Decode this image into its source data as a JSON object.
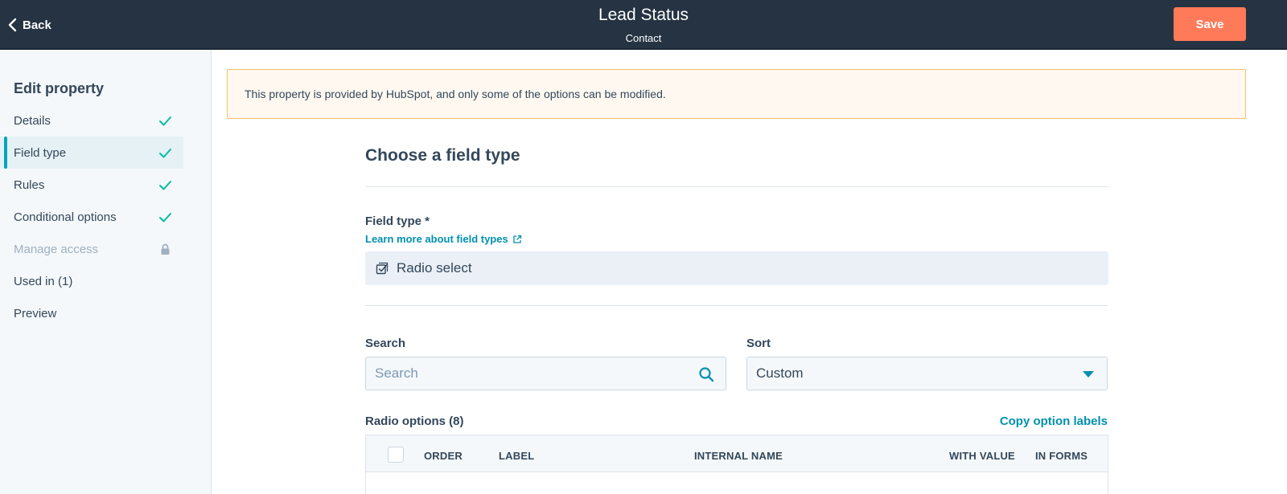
{
  "header": {
    "back_label": "Back",
    "title": "Lead Status",
    "subtitle": "Contact",
    "save_label": "Save"
  },
  "sidebar": {
    "title": "Edit property",
    "items": [
      {
        "label": "Details",
        "status": "check-icon"
      },
      {
        "label": "Field type",
        "status": "check-icon",
        "active": true
      },
      {
        "label": "Rules",
        "status": "check-icon"
      },
      {
        "label": "Conditional options",
        "status": "check-icon"
      },
      {
        "label": "Manage access",
        "status": "lock-icon",
        "disabled": true
      },
      {
        "label": "Used in (1)"
      },
      {
        "label": "Preview"
      }
    ]
  },
  "banner": {
    "text": "This property is provided by HubSpot, and only some of the options can be modified."
  },
  "main": {
    "section_title": "Choose a field type",
    "field_type_label": "Field type *",
    "learn_link": "Learn more about field types",
    "field_type_value": "Radio select",
    "search_label": "Search",
    "search_placeholder": "Search",
    "sort_label": "Sort",
    "sort_value": "Custom",
    "options_label": "Radio options (8)",
    "copy_link": "Copy option labels",
    "table_headers": [
      "ORDER",
      "LABEL",
      "INTERNAL NAME",
      "WITH VALUE",
      "IN FORMS"
    ]
  },
  "colors": {
    "header_bg": "#253342",
    "accent": "#ff7a59",
    "link": "#0091ae",
    "check": "#00bda5",
    "active_bar": "#00a4bd"
  }
}
